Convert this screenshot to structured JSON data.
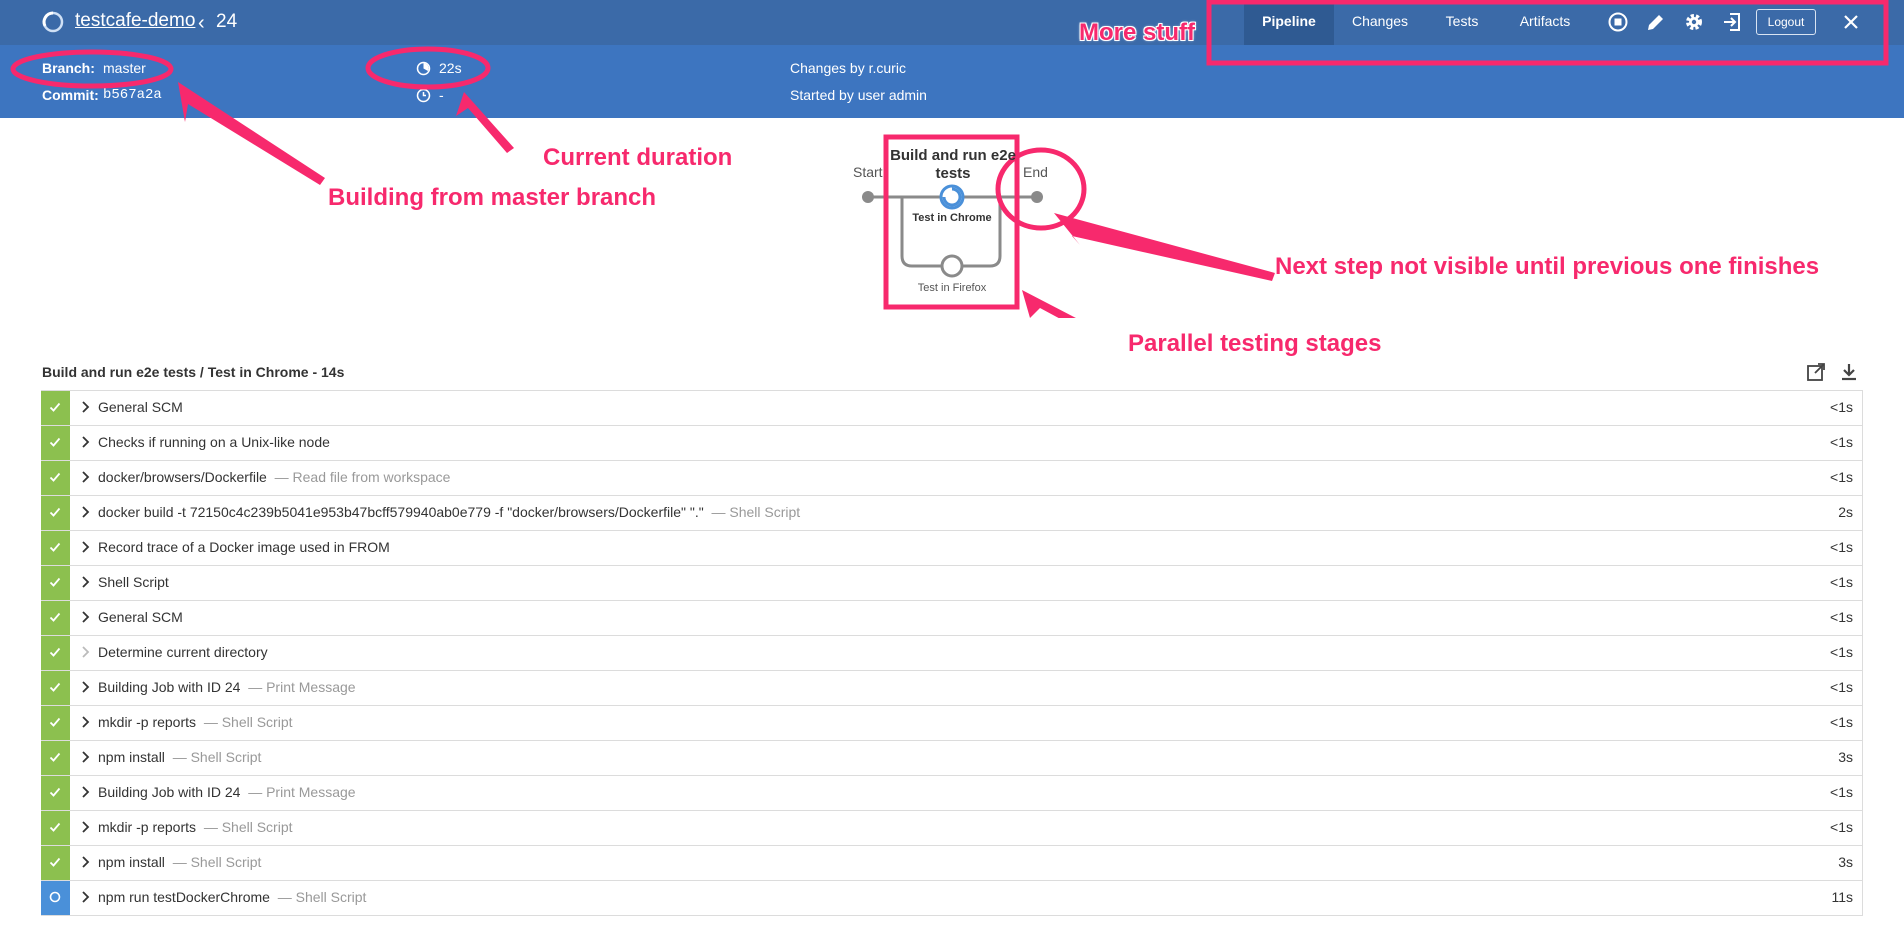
{
  "header": {
    "job_name": "testcafe-demo",
    "back_chevron": "‹",
    "run_number": "24",
    "tabs": [
      {
        "label": "Pipeline",
        "active": true
      },
      {
        "label": "Changes",
        "active": false
      },
      {
        "label": "Tests",
        "active": false
      },
      {
        "label": "Artifacts",
        "active": false
      }
    ],
    "tools": [
      "stop-icon",
      "edit-icon",
      "gear-icon",
      "exit-icon"
    ],
    "logout_label": "Logout",
    "close_icon": "×"
  },
  "run_info": {
    "branch_label": "Branch:",
    "branch_value": "master",
    "commit_label": "Commit:",
    "commit_value": "b567a2a",
    "duration_value": "22s",
    "time_value": "-",
    "changes_text": "Changes by r.curic",
    "started_text": "Started by user admin"
  },
  "graph": {
    "start_label": "Start",
    "end_label": "End",
    "stage_title": "Build and run e2e tests",
    "branches": [
      "Test in Chrome",
      "Test in Firefox"
    ]
  },
  "annotations": {
    "more_stuff": "More stuff",
    "current_duration": "Current duration",
    "building_from_master": "Building from master branch",
    "next_step": "Next step not visible until previous one finishes",
    "parallel": "Parallel testing stages",
    "color": "#f7296d"
  },
  "log": {
    "heading": "Build and run e2e tests / Test in Chrome - 14s",
    "tools": [
      "open-in-new-window-icon",
      "download-icon"
    ]
  },
  "steps": [
    {
      "title": "General SCM",
      "sub": "",
      "duration": "<1s",
      "status": "success"
    },
    {
      "title": "Checks if running on a Unix-like node",
      "sub": "",
      "duration": "<1s",
      "status": "success"
    },
    {
      "title": "docker/browsers/Dockerfile",
      "sub": "— Read file from workspace",
      "duration": "<1s",
      "status": "success"
    },
    {
      "title": "docker build -t 72150c4c239b5041e953b47bcff579940ab0e779 -f \"docker/browsers/Dockerfile\" \".\"",
      "sub": "— Shell Script",
      "duration": "2s",
      "status": "success"
    },
    {
      "title": "Record trace of a Docker image used in FROM",
      "sub": "",
      "duration": "<1s",
      "status": "success"
    },
    {
      "title": "Shell Script",
      "sub": "",
      "duration": "<1s",
      "status": "success"
    },
    {
      "title": "General SCM",
      "sub": "",
      "duration": "<1s",
      "status": "success"
    },
    {
      "title": "Determine current directory",
      "sub": "",
      "duration": "<1s",
      "status": "success",
      "muted_chevron": true
    },
    {
      "title": "Building Job with ID 24",
      "sub": "— Print Message",
      "duration": "<1s",
      "status": "success"
    },
    {
      "title": "mkdir -p reports",
      "sub": "— Shell Script",
      "duration": "<1s",
      "status": "success"
    },
    {
      "title": "npm install",
      "sub": "— Shell Script",
      "duration": "3s",
      "status": "success"
    },
    {
      "title": "Building Job with ID 24",
      "sub": "— Print Message",
      "duration": "<1s",
      "status": "success"
    },
    {
      "title": "mkdir -p reports",
      "sub": "— Shell Script",
      "duration": "<1s",
      "status": "success"
    },
    {
      "title": "npm install",
      "sub": "— Shell Script",
      "duration": "3s",
      "status": "success"
    },
    {
      "title": "npm run testDockerChrome",
      "sub": "— Shell Script",
      "duration": "11s",
      "status": "running"
    }
  ]
}
